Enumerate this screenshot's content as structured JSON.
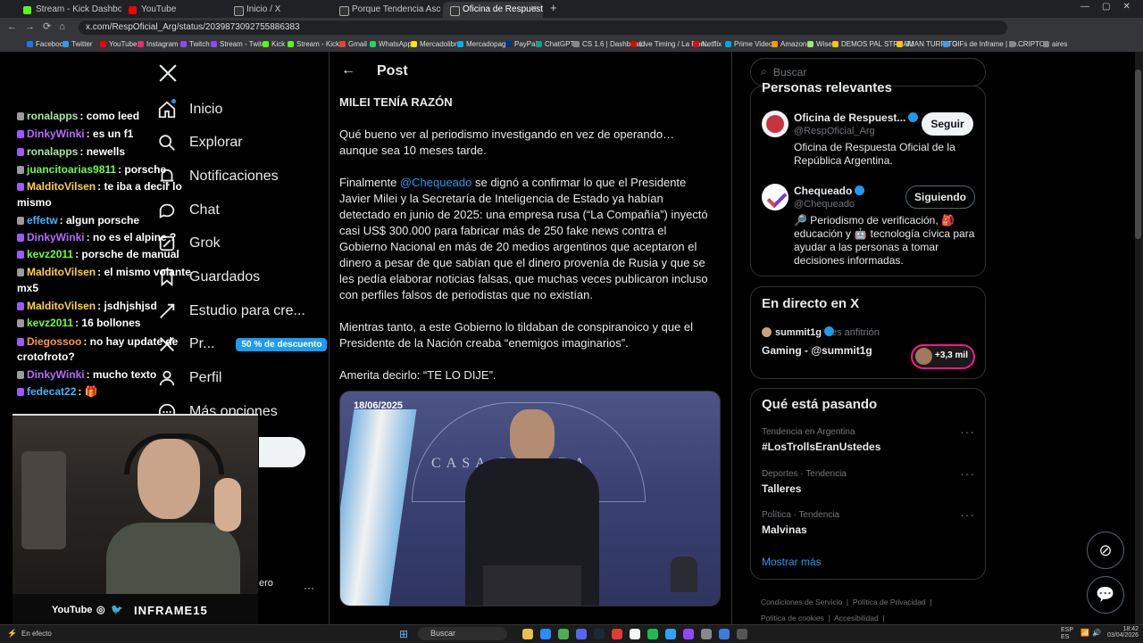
{
  "tabs": [
    {
      "label": "Stream - Kick Dashboard",
      "color": "#53fc18"
    },
    {
      "label": "YouTube",
      "color": "#ff0000"
    },
    {
      "label": "Inicio / X",
      "color": "#e7e9ea"
    },
    {
      "label": "Porque Tendencia Ascenso en X",
      "color": "#e7e9ea"
    },
    {
      "label": "Oficina de Respuesta Oficial",
      "color": "#e7e9ea"
    }
  ],
  "new_tab": "+",
  "url": "x.com/RespOficial_Arg/status/2039873092755886383",
  "bookmarks": [
    "Facebook",
    "Twitter",
    "YouTube",
    "Instagram",
    "Twitch",
    "Stream - Twitch",
    "Kick",
    "Stream - Kick",
    "Gmail",
    "WhatsApp",
    "Mercadolibre",
    "Mercadopago",
    "PayPal",
    "ChatGPT",
    "CS 1.6 | Dashboard",
    "Live Timing / La Ron...",
    "Netflix",
    "Prime Video",
    "Amazon.",
    "Wise",
    "DEMOS PAL STREAM",
    "JUAN TURRITO",
    "GIFs de Inframe | Te...",
    "CRIPTO",
    "aires"
  ],
  "chat": [
    {
      "user": "ronalapps",
      "msg": ": como leed",
      "color": "#a8e6a3"
    },
    {
      "user": "DinkyWinki",
      "msg": ": es un f1",
      "color": "#b46bff"
    },
    {
      "user": "ronalapps",
      "msg": ": newells",
      "color": "#a8e6a3"
    },
    {
      "user": "juancitoarias9811",
      "msg": ": porsche",
      "color": "#6cff3a"
    },
    {
      "user": "MalditoVilsen",
      "msg": ": te iba a decir lo",
      "color": "#ffd23a"
    },
    {
      "user": "",
      "msg": "mismo",
      "color": "#fff"
    },
    {
      "user": "effetw",
      "msg": ": algun porsche",
      "color": "#3ab6ff"
    },
    {
      "user": "DinkyWinki",
      "msg": ": no es el alpine ?",
      "color": "#b46bff"
    },
    {
      "user": "kevz2011",
      "msg": ": porsche de manual",
      "color": "#6cff3a"
    },
    {
      "user": "MalditoVilsen",
      "msg": ": el mismo volante",
      "color": "#ffd23a"
    },
    {
      "user": "",
      "msg": "mx5",
      "color": "#fff"
    },
    {
      "user": "MalditoVilsen",
      "msg": ": jsdhjshjsd",
      "color": "#ffd23a"
    },
    {
      "user": "kevz2011",
      "msg": ": 16 bollones",
      "color": "#6cff3a"
    },
    {
      "user": "Diegossoo",
      "msg": ": no hay update de",
      "color": "#ff9a3a"
    },
    {
      "user": "",
      "msg": "crotofroto?",
      "color": "#fff"
    },
    {
      "user": "DinkyWinki",
      "msg": ": mucho texto",
      "color": "#b46bff"
    },
    {
      "user": "fedecat22",
      "msg": ": 🎁",
      "color": "#3ab6ff"
    }
  ],
  "nav": {
    "items": [
      "Inicio",
      "Explorar",
      "Notificaciones",
      "Chat",
      "Grok",
      "Guardados",
      "Estudio para cre...",
      "Pr...",
      "Perfil",
      "Más opciones"
    ],
    "promo": "50 % de descuento",
    "partial_name": "ero",
    "more": "···"
  },
  "cam_footer": {
    "youtube": "YouTube",
    "brand": "INFRAME15"
  },
  "post": {
    "header": "Post",
    "headline": "MILEI TENÍA RAZÓN",
    "p1": "Qué bueno ver al periodismo investigando en vez de operando… aunque sea 10 meses tarde.",
    "p2_before": "Finalmente ",
    "p2_mention": "@Chequeado",
    "p2_after": " se dignó a confirmar lo que el Presidente Javier Milei y la Secretaría de Inteligencia de Estado ya habían detectado en junio de 2025: una empresa rusa (“La Compañía”) inyectó casi US$ 300.000 para fabricar más de 250 fake news contra el Gobierno Nacional en más de 20 medios argentinos que aceptaron el dinero a pesar de que sabían que el dinero provenía de Rusia y que se les pedía elaborar noticias falsas, que muchas veces publicaron incluso con perfiles falsos de periodistas que no existían.",
    "p3": "Mientras tanto, a este Gobierno lo tildaban de conspiranoico y que el Presidente de la Nación creaba “enemigos imaginarios”.",
    "p4": "Amerita decirlo: “TE LO DIJE”.",
    "video_date": "18/06/2025",
    "video_sign": "CASA ROSADA"
  },
  "right": {
    "search_placeholder": "Buscar",
    "relevant_title": "Personas relevantes",
    "people": [
      {
        "name": "Oficina de Respuest...",
        "handle": "@RespOficial_Arg",
        "bio": "Oficina de Respuesta Oficial de la República Argentina.",
        "button": "Seguir"
      },
      {
        "name": "Chequeado",
        "handle": "@Chequeado",
        "bio": "🔎 Periodismo de verificación, 🎒 educación y 🤖 tecnología cívica para ayudar a las personas a tomar decisiones informadas.",
        "button": "Siguiendo"
      }
    ],
    "live_title": "En directo en X",
    "live_host": "summit1g",
    "live_role": "es anfitrión",
    "live_name": "Gaming - @summit1g",
    "live_count": "+3,3 mil",
    "trending_title": "Qué está pasando",
    "trends": [
      {
        "cat": "Tendencia en Argentina",
        "name": "#LosTrollsEranUstedes"
      },
      {
        "cat": "Deportes · Tendencia",
        "name": "Talleres"
      },
      {
        "cat": "Política · Tendencia",
        "name": "Malvinas"
      }
    ],
    "show_more": "Mostrar más",
    "footer": [
      "Condiciones de Servicio",
      "Política de Privacidad",
      "Política de cookies",
      "Accesibilidad"
    ]
  },
  "taskbar": {
    "status": "En efecto",
    "search": "Buscar",
    "lang": "ESP\nES",
    "time": "18:42",
    "date": "03/04/2026"
  }
}
